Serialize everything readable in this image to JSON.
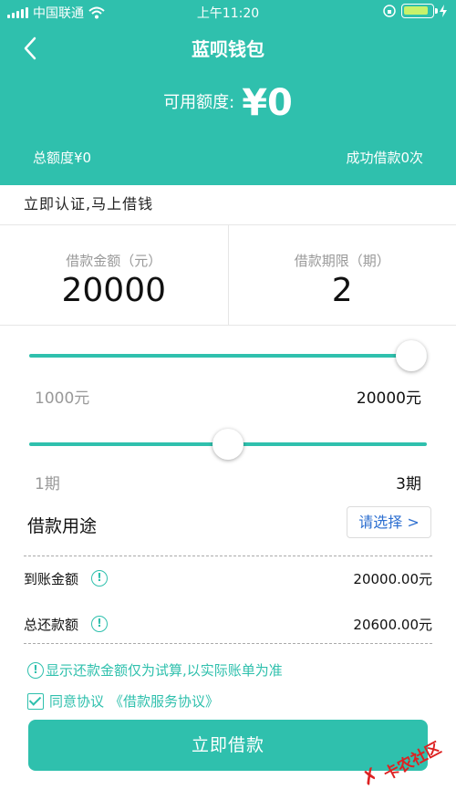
{
  "status_bar": {
    "carrier": "中国联通",
    "time": "上午11:20"
  },
  "nav": {
    "title": "蓝呗钱包"
  },
  "credit": {
    "available_label": "可用额度:",
    "available_value": "¥0",
    "total_label": "总额度¥0",
    "success_label": "成功借款0次"
  },
  "verify_banner": "立即认证,马上借钱",
  "loan": {
    "amount_label": "借款金额（元）",
    "amount_value": "20000",
    "term_label": "借款期限（期）",
    "term_value": "2"
  },
  "amount_slider": {
    "min_label": "1000元",
    "max_label": "20000元",
    "level": 1.0
  },
  "term_slider": {
    "min_label": "1期",
    "max_label": "3期",
    "level": 0.5
  },
  "purpose": {
    "label": "借款用途",
    "select_label": "请选择 >"
  },
  "summary": {
    "arrival_label": "到账金额",
    "arrival_value": "20000.00元",
    "repay_label": "总还款额",
    "repay_value": "20600.00元"
  },
  "notice": "显示还款金额仅为试算,以实际账单为准",
  "agreement": {
    "prefix": "同意协议",
    "link": "《借款服务协议》"
  },
  "submit_label": "立即借款",
  "watermark": "卡农社区",
  "colors": {
    "accent": "#2fc0ad",
    "link": "#2d6fd0",
    "watermark": "#d22222"
  }
}
